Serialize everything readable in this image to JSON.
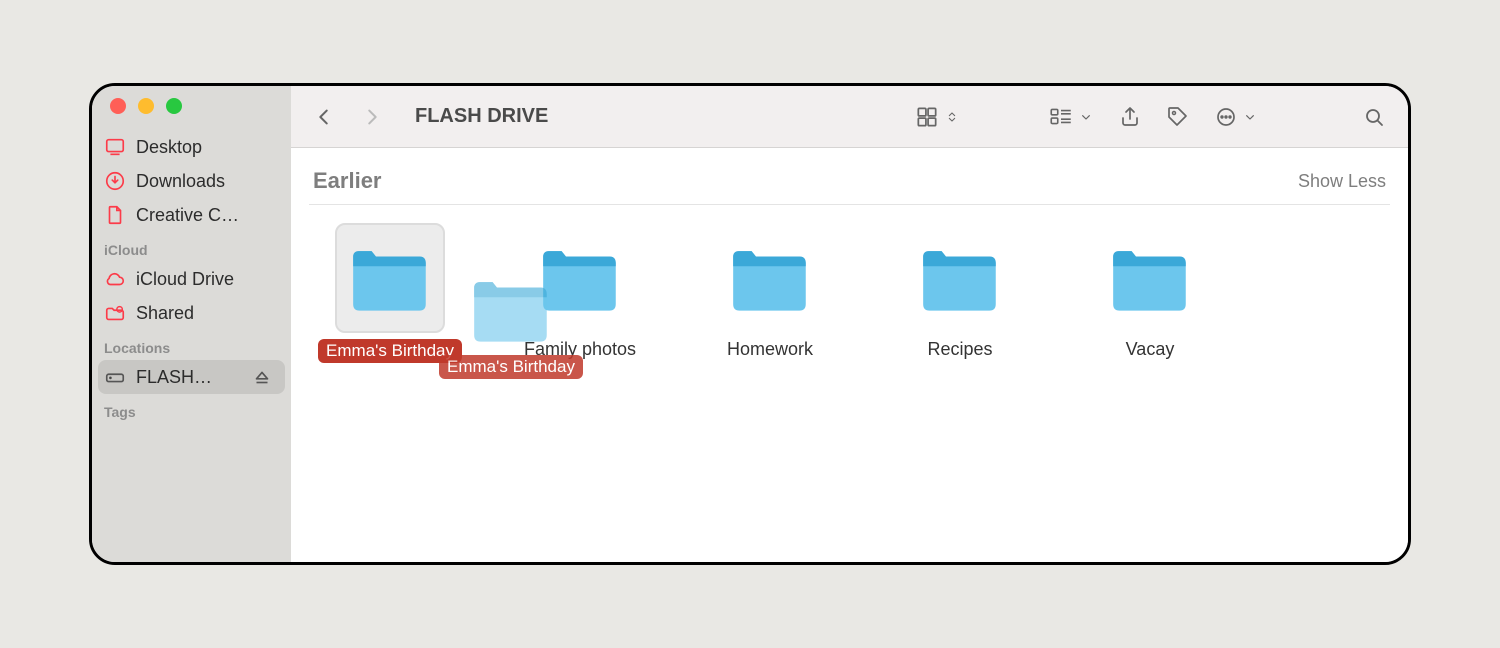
{
  "window": {
    "title": "FLASH DRIVE"
  },
  "sidebar": {
    "favorites": [
      {
        "label": "Desktop",
        "icon": "desktop-icon"
      },
      {
        "label": "Downloads",
        "icon": "downloads-icon"
      },
      {
        "label": "Creative C…",
        "icon": "file-icon"
      }
    ],
    "icloud_title": "iCloud",
    "icloud": [
      {
        "label": "iCloud Drive",
        "icon": "cloud-icon"
      },
      {
        "label": "Shared",
        "icon": "shared-folder-icon"
      }
    ],
    "locations_title": "Locations",
    "locations": [
      {
        "label": "FLASH…",
        "icon": "drive-icon",
        "selected": true
      }
    ],
    "tags_title": "Tags"
  },
  "section": {
    "title": "Earlier",
    "toggle": "Show Less"
  },
  "folders": [
    {
      "label": "Emma's Birthday",
      "selected": true
    },
    {
      "label": "Family photos"
    },
    {
      "label": "Homework"
    },
    {
      "label": "Recipes"
    },
    {
      "label": "Vacay"
    }
  ],
  "drag": {
    "label": "Emma's Birthday"
  },
  "colors": {
    "accent_red": "#fc3b49",
    "folder_blue_light": "#6cc6ed",
    "folder_blue_dark": "#3ba8d8",
    "selection_red": "#c0392b"
  }
}
